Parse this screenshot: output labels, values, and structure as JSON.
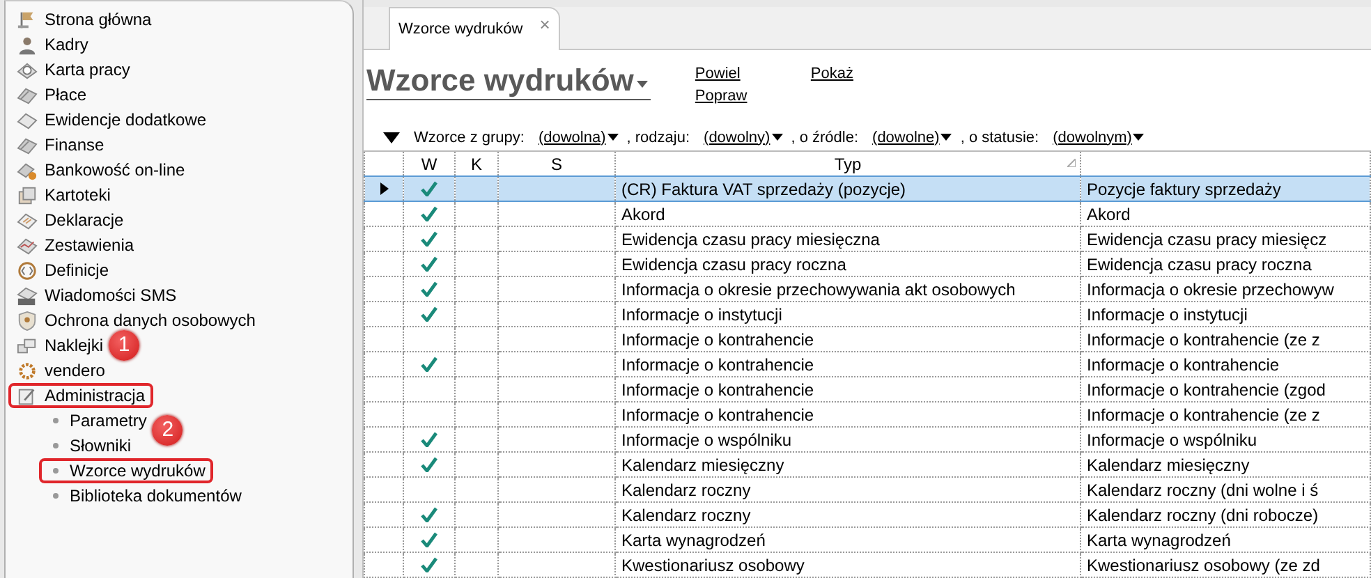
{
  "sidebar": {
    "items": [
      {
        "label": "Strona główna"
      },
      {
        "label": "Kadry"
      },
      {
        "label": "Karta pracy"
      },
      {
        "label": "Płace"
      },
      {
        "label": "Ewidencje dodatkowe"
      },
      {
        "label": "Finanse"
      },
      {
        "label": "Bankowość on-line"
      },
      {
        "label": "Kartoteki"
      },
      {
        "label": "Deklaracje"
      },
      {
        "label": "Zestawienia"
      },
      {
        "label": "Definicje"
      },
      {
        "label": "Wiadomości SMS"
      },
      {
        "label": "Ochrona danych osobowych"
      },
      {
        "label": "Naklejki",
        "annotation": "1"
      },
      {
        "label": "vendero"
      },
      {
        "label": "Administracja",
        "highlighted": true,
        "children": [
          {
            "label": "Parametry",
            "annotation": "2"
          },
          {
            "label": "Słowniki"
          },
          {
            "label": "Wzorce wydruków",
            "highlighted": true
          },
          {
            "label": "Biblioteka dokumentów"
          }
        ]
      }
    ]
  },
  "tabs": [
    {
      "label": "Wzorce wydruków",
      "close": "×",
      "selected": true
    }
  ],
  "page_title": "Wzorce wydruków",
  "actions": [
    "Powiel",
    "Popraw",
    "Pokaż"
  ],
  "filters": [
    {
      "label": "Wzorce z grupy:",
      "value": "(dowolna)"
    },
    {
      "label": ", rodzaju:",
      "value": "(dowolny)"
    },
    {
      "label": ", o źródle:",
      "value": "(dowolne)"
    },
    {
      "label": ", o statusie:",
      "value": "(dowolnym)"
    }
  ],
  "table": {
    "columns": [
      "W",
      "K",
      "S",
      "Typ"
    ],
    "rows": [
      {
        "selected": true,
        "w": true,
        "typ": "(CR) Faktura VAT sprzedaży (pozycje)",
        "column_6": "Pozycje faktury sprzedaży"
      },
      {
        "selected": false,
        "w": true,
        "typ": "Akord",
        "column_6": "Akord"
      },
      {
        "selected": false,
        "w": true,
        "typ": "Ewidencja czasu pracy miesięczna",
        "column_6": "Ewidencja czasu pracy miesięcz"
      },
      {
        "selected": false,
        "w": true,
        "typ": "Ewidencja czasu pracy roczna",
        "column_6": "Ewidencja czasu pracy roczna"
      },
      {
        "selected": false,
        "w": true,
        "typ": "Informacja o okresie przechowywania akt osobowych",
        "column_6": "Informacja o okresie przechowyw"
      },
      {
        "selected": false,
        "w": true,
        "typ": "Informacje o instytucji",
        "column_6": "Informacje o instytucji"
      },
      {
        "selected": false,
        "w": false,
        "typ": "Informacje o kontrahencie",
        "column_6": "Informacje o kontrahencie (ze z"
      },
      {
        "selected": false,
        "w": true,
        "typ": "Informacje o kontrahencie",
        "column_6": "Informacje o kontrahencie"
      },
      {
        "selected": false,
        "w": false,
        "typ": "Informacje o kontrahencie",
        "column_6": "Informacje o kontrahencie (zgod"
      },
      {
        "selected": false,
        "w": false,
        "typ": "Informacje o kontrahencie",
        "column_6": "Informacje o kontrahencie (ze z"
      },
      {
        "selected": false,
        "w": true,
        "typ": "Informacje o wspólniku",
        "column_6": "Informacje o wspólniku"
      },
      {
        "selected": false,
        "w": true,
        "typ": "Kalendarz miesięczny",
        "column_6": "Kalendarz miesięczny"
      },
      {
        "selected": false,
        "w": false,
        "typ": "Kalendarz roczny",
        "column_6": "Kalendarz roczny (dni wolne i ś"
      },
      {
        "selected": false,
        "w": true,
        "typ": "Kalendarz roczny",
        "column_6": "Kalendarz roczny (dni robocze)"
      },
      {
        "selected": false,
        "w": true,
        "typ": "Karta wynagrodzeń",
        "column_6": "Karta wynagrodzeń"
      },
      {
        "selected": false,
        "w": true,
        "typ": "Kwestionariusz osobowy",
        "column_6": "Kwestionariusz osobowy (ze zd"
      }
    ]
  }
}
